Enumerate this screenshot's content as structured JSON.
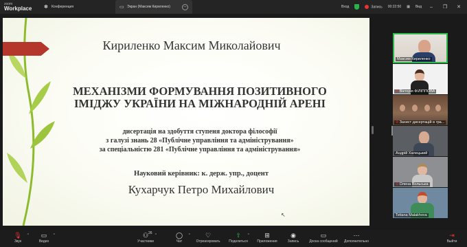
{
  "app": {
    "logo_top": "zoom",
    "logo_bottom": "Workplace"
  },
  "tabs": [
    {
      "label": "Конференция"
    },
    {
      "label": "Экран (Максим Кириленко)"
    }
  ],
  "titlebar_right": {
    "view_label": "Вход",
    "record_label": "Запись",
    "timer": "00:22:50",
    "view_menu": "Вид"
  },
  "slide": {
    "author": "Кириленко Максим Миколайович",
    "title_line1": "МЕХАНІЗМИ ФОРМУВАННЯ ПОЗИТИВНОГО",
    "title_line2": "ІМІДЖУ УКРАЇНИ НА МІЖНАРОДНІЙ АРЕНІ",
    "sub_line1": "дисертація на здобуття ступеня доктора філософії",
    "sub_line2": "з галузі знань 28 «Публічне управління та адміністрування»",
    "sub_line3": "за спеціальністю 281 «Публічне управління та адміністрування»",
    "supervisor_label": "Науковий керівник: к. держ. упр., доцент",
    "supervisor_name": "Кухарчук Петро Михайлович",
    "colors": {
      "arrow": "#b5362a",
      "leaf": "#8cbc2e"
    }
  },
  "participants": [
    {
      "name": "Максим Кириленко",
      "muted": false
    },
    {
      "name": "Вікторія ФІЛІППОВА",
      "muted": true
    },
    {
      "name": "Захист дисертацій в гра...",
      "muted": true
    },
    {
      "name": "Андрій Халецький",
      "muted": false
    },
    {
      "name": "Олена Вольська",
      "muted": true
    },
    {
      "name": "Tetiana Malakhova",
      "muted": false
    }
  ],
  "toolbar": {
    "audio": {
      "label": "Звук",
      "icon": "mic-off-icon"
    },
    "video": {
      "label": "Видео",
      "icon": "camera-icon"
    },
    "participants": {
      "label": "Участники",
      "icon": "people-icon",
      "count": "26"
    },
    "chat": {
      "label": "Чат",
      "icon": "chat-icon"
    },
    "react": {
      "label": "Отреагировать",
      "icon": "heart-icon"
    },
    "share": {
      "label": "Поделиться",
      "icon": "share-icon"
    },
    "apps": {
      "label": "Приложения",
      "icon": "apps-icon"
    },
    "record": {
      "label": "Запись",
      "icon": "record-icon"
    },
    "meeting_messages": {
      "label": "Доска сообщений",
      "icon": "whiteboard-icon"
    },
    "more": {
      "label": "Дополнительно",
      "icon": "more-icon"
    },
    "leave": {
      "label": "Выйти",
      "icon": "leave-icon"
    }
  }
}
